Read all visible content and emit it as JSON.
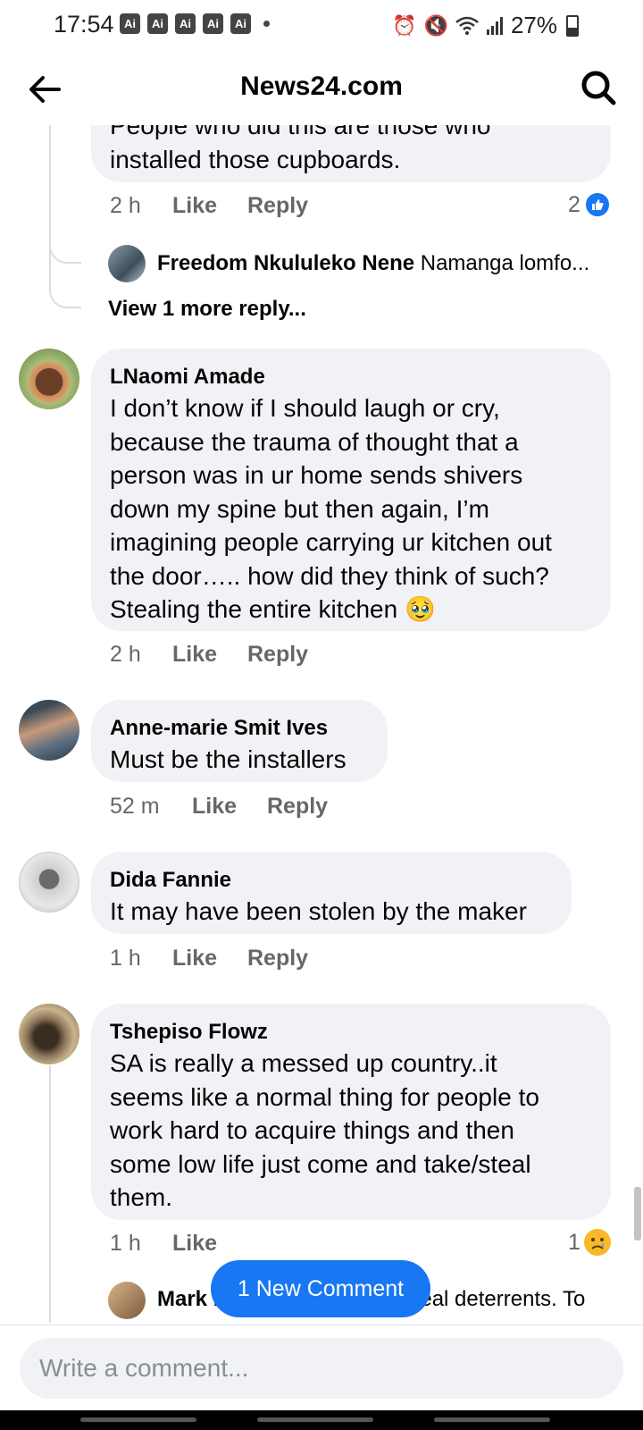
{
  "status_bar": {
    "time": "17:54",
    "ai_badges": [
      "Ai",
      "Ai",
      "Ai",
      "Ai",
      "Ai"
    ],
    "battery": "27%"
  },
  "app_bar": {
    "title": "News24.com"
  },
  "comments": [
    {
      "text_partial_top": "People who did this are those who",
      "text": "installed those cupboards.",
      "time": "2 h",
      "like_label": "Like",
      "reply_label": "Reply",
      "reaction_count": "2",
      "reaction": "like"
    }
  ],
  "reply_preview": {
    "author": "Freedom Nkululeko Nene",
    "text": "Namanga lomfo...",
    "more": "View 1 more reply..."
  },
  "comment_lnaomi": {
    "author": "LNaomi Amade",
    "lines": [
      "I don’t know if I should laugh or cry,",
      "because the trauma of thought that a",
      "person was in ur home sends shivers",
      "down my spine but then again, I’m",
      "imagining people carrying ur kitchen out",
      "the door….. how did they think of such?",
      "Stealing the entire kitchen 🥹"
    ],
    "time": "2 h",
    "like_label": "Like",
    "reply_label": "Reply"
  },
  "comment_anne": {
    "author": "Anne-marie Smit Ives",
    "text": "Must be the installers",
    "time": "52 m",
    "like_label": "Like",
    "reply_label": "Reply"
  },
  "comment_dida": {
    "author": "Dida Fannie",
    "text": "It may have been stolen by the maker",
    "time": "1 h",
    "like_label": "Like",
    "reply_label": "Reply"
  },
  "comment_tshepiso": {
    "author": "Tshepiso Flowz",
    "lines": [
      "SA is really a messed up country..it",
      "seems like a normal thing for people to",
      "work hard to acquire things and then",
      "some low life just come and take/steal",
      "them."
    ],
    "time": "1 h",
    "like_label": "Like",
    "reaction_count": "1",
    "reaction": "sad"
  },
  "reply_preview_bottom": {
    "author": "Mark Rusby",
    "text": "There are no real deterrents. To"
  },
  "new_comment_pill": "1 New Comment",
  "composer": {
    "placeholder": "Write a comment..."
  },
  "colors": {
    "accent": "#1877f2",
    "bubble": "#f0f2f5",
    "meta": "#65676b"
  }
}
